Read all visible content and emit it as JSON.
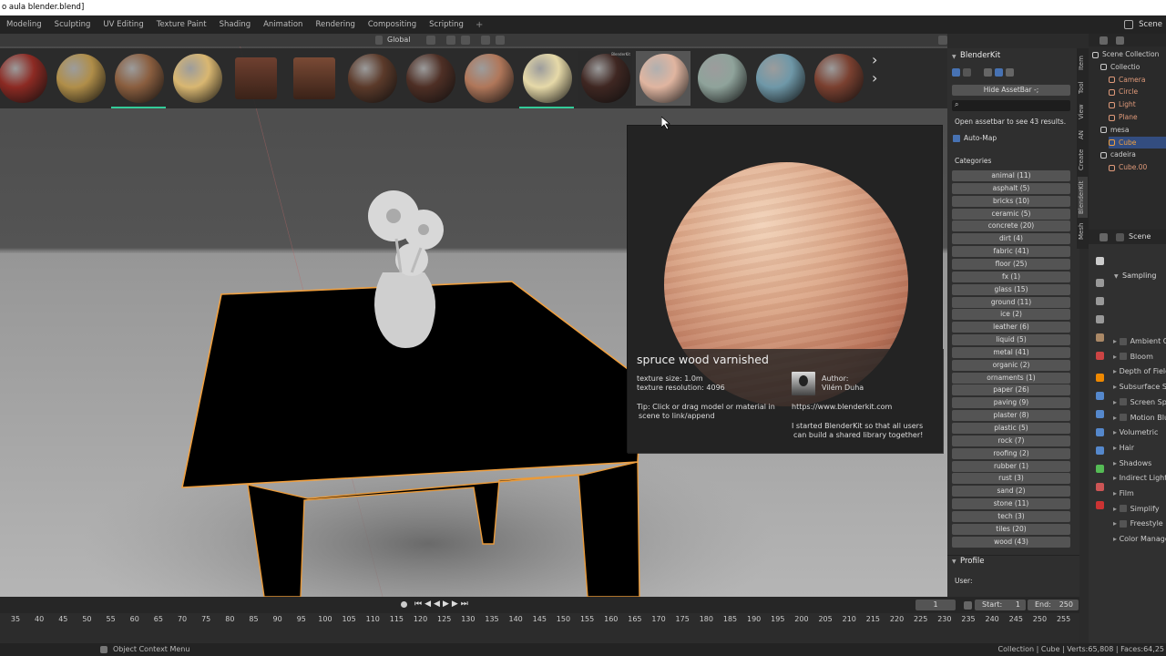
{
  "title_bar": {
    "text": "o aula blender.blend]"
  },
  "workspaces": [
    "Modeling",
    "Sculpting",
    "UV Editing",
    "Texture Paint",
    "Shading",
    "Animation",
    "Rendering",
    "Compositing",
    "Scripting"
  ],
  "workspace_add": "+",
  "scene": {
    "label": "Scene"
  },
  "viewport_header": {
    "orientation": "Global"
  },
  "assetbar": {
    "thumbs": [
      {
        "color": "#8c2a23",
        "shape": "sphere",
        "underline": false
      },
      {
        "color": "#b08e49",
        "shape": "sphere",
        "underline": false
      },
      {
        "color": "#8a5e3f",
        "shape": "sphere",
        "underline": true
      },
      {
        "color": "#d9b771",
        "shape": "sphere",
        "underline": false
      },
      {
        "color": "#6f4030",
        "shape": "cube",
        "underline": false
      },
      {
        "color": "#7a4a35",
        "shape": "cube",
        "underline": false
      },
      {
        "color": "#5b3a2a",
        "shape": "sphere",
        "underline": false
      },
      {
        "color": "#4e2f25",
        "shape": "sphere",
        "underline": false
      },
      {
        "color": "#b0775a",
        "shape": "sphere",
        "underline": false
      },
      {
        "color": "#e6d9a8",
        "shape": "sphere",
        "underline": true
      },
      {
        "color": "#3f2722",
        "shape": "sphere",
        "underline": false
      },
      {
        "color": "#e0b5a0",
        "shape": "sphere",
        "underline": false
      },
      {
        "color": "#8fa39b",
        "shape": "sphere",
        "underline": false
      },
      {
        "color": "#6f98a8",
        "shape": "sphere",
        "underline": false
      },
      {
        "color": "#7a4030",
        "shape": "sphere",
        "underline": false
      }
    ],
    "selected_index": 10,
    "hovered_index": 11,
    "thumb_badge": "BlenderKit"
  },
  "preview": {
    "name": "spruce wood varnished",
    "texture_size": "texture size: 1.0m",
    "texture_resolution": "texture resolution: 4096",
    "tip_line1": "Tip: Click or drag model or material in",
    "tip_line2": "scene to link/append",
    "author_label": "Author:",
    "author_name": "Vilém Duha",
    "url": "https://www.blenderkit.com",
    "blurb_line1": "I started BlenderKit so that all users",
    "blurb_line2": "can build a shared library together!"
  },
  "npanel": {
    "header": "BlenderKit",
    "hide_assetbar": "Hide AssetBar",
    "hide_shortcut": "-;",
    "open_assetbar": "Open assetbar to see 43 results.",
    "automap": "Auto-Map",
    "categories_label": "Categories",
    "categories": [
      "animal (11)",
      "asphalt (5)",
      "bricks (10)",
      "ceramic (5)",
      "concrete (20)",
      "dirt (4)",
      "fabric (41)",
      "floor (25)",
      "fx (1)",
      "glass (15)",
      "ground (11)",
      "ice (2)",
      "leather (6)",
      "liquid (5)",
      "metal (41)",
      "organic (2)",
      "ornaments (1)",
      "paper (26)",
      "paving (9)",
      "plaster (8)",
      "plastic (5)",
      "rock (7)",
      "roofing (2)",
      "rubber (1)",
      "rust (3)",
      "sand (2)",
      "stone (11)",
      "tech (3)",
      "tiles (20)",
      "wood (43)"
    ],
    "profile_header": "Profile",
    "user_label": "User:",
    "tabs": [
      "Item",
      "Tool",
      "View",
      "AN",
      "Create",
      "BlenderKit",
      "Mesh"
    ]
  },
  "outliner": {
    "rows": [
      {
        "indent": 0,
        "label": "Scene Collection",
        "color": "#ccc"
      },
      {
        "indent": 1,
        "label": "Collectio",
        "color": "#ccc"
      },
      {
        "indent": 2,
        "label": "Camera",
        "color": "#e09a7a"
      },
      {
        "indent": 2,
        "label": "Circle",
        "color": "#e09a7a"
      },
      {
        "indent": 2,
        "label": "Light",
        "color": "#e09a7a"
      },
      {
        "indent": 2,
        "label": "Plane",
        "color": "#e09a7a"
      },
      {
        "indent": 1,
        "label": "mesa",
        "color": "#ccc"
      },
      {
        "indent": 2,
        "label": "Cube",
        "color": "#f0a040"
      },
      {
        "indent": 1,
        "label": "cadeira",
        "color": "#ccc"
      },
      {
        "indent": 2,
        "label": "Cube.00",
        "color": "#e09a7a"
      }
    ]
  },
  "properties": {
    "scene_label": "Scene",
    "sampling": "Sampling",
    "rows": [
      {
        "label": "Ambient C",
        "type": "check",
        "arrow": true
      },
      {
        "label": "Bloom",
        "type": "check",
        "arrow": true
      },
      {
        "label": "Depth of Field",
        "type": "plain",
        "arrow": true
      },
      {
        "label": "Subsurface S",
        "type": "plain",
        "arrow": true
      },
      {
        "label": "Screen Sp",
        "type": "check",
        "arrow": true
      },
      {
        "label": "Motion Blu",
        "type": "check",
        "arrow": true
      },
      {
        "label": "Volumetric",
        "type": "plain",
        "arrow": true
      },
      {
        "label": "Hair",
        "type": "plain",
        "arrow": true
      },
      {
        "label": "Shadows",
        "type": "plain",
        "arrow": true
      },
      {
        "label": "Indirect Light",
        "type": "plain",
        "arrow": true
      },
      {
        "label": "Film",
        "type": "plain",
        "arrow": true
      },
      {
        "label": "Simplify",
        "type": "check",
        "arrow": true
      },
      {
        "label": "Freestyle",
        "type": "check",
        "arrow": true
      },
      {
        "label": "Color Manage",
        "type": "plain",
        "arrow": true
      }
    ]
  },
  "timeline": {
    "current_frame": "1",
    "start_label": "Start:",
    "start_value": "1",
    "end_label": "End:",
    "end_value": "250",
    "ruler": [
      "35",
      "40",
      "45",
      "50",
      "55",
      "60",
      "65",
      "70",
      "75",
      "80",
      "85",
      "90",
      "95",
      "100",
      "105",
      "110",
      "115",
      "120",
      "125",
      "130",
      "135",
      "140",
      "145",
      "150",
      "155",
      "160",
      "165",
      "170",
      "175",
      "180",
      "185",
      "190",
      "195",
      "200",
      "205",
      "210",
      "215",
      "220",
      "225",
      "230",
      "235",
      "240",
      "245",
      "250",
      "255"
    ]
  },
  "statusbar": {
    "left": "Object Context Menu",
    "right": "Collection | Cube | Verts:65,808 | Faces:64,25"
  }
}
